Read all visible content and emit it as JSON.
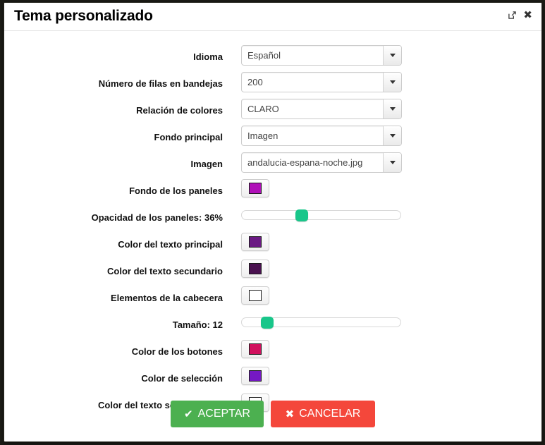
{
  "dialog": {
    "title": "Tema personalizado",
    "expand_icon": "external-link-icon",
    "close_icon": "✖"
  },
  "rows": [
    {
      "label": "Idioma",
      "type": "select",
      "value": "Español"
    },
    {
      "label": "Número de filas en bandejas",
      "type": "select",
      "value": "200"
    },
    {
      "label": "Relación de colores",
      "type": "select",
      "value": "CLARO"
    },
    {
      "label": "Fondo principal",
      "type": "select",
      "value": "Imagen"
    },
    {
      "label": "Imagen",
      "type": "select",
      "value": "andalucia-espana-noche.jpg"
    },
    {
      "label": "Fondo de los paneles",
      "type": "color",
      "color": "#b010b8"
    },
    {
      "label": "Opacidad de los paneles: 36%",
      "type": "slider",
      "percent": 36,
      "thumb_color": "#19c68a"
    },
    {
      "label": "Color del texto principal",
      "type": "color",
      "color": "#6b1a84"
    },
    {
      "label": "Color del texto secundario",
      "type": "color",
      "color": "#4a1150"
    },
    {
      "label": "Elementos de la cabecera",
      "type": "color",
      "color": "#ffffff"
    },
    {
      "label": "Tamaño: 12",
      "type": "slider",
      "percent": 12,
      "thumb_color": "#19c68a"
    },
    {
      "label": "Color de los botones",
      "type": "color",
      "color": "#d1115e"
    },
    {
      "label": "Color de selección",
      "type": "color",
      "color": "#7518c4"
    },
    {
      "label": "Color del texto seleccionado",
      "type": "color",
      "color": "#ffffff"
    }
  ],
  "footer": {
    "accept_label": "ACEPTAR",
    "accept_glyph": "✔",
    "accept_color": "#4cb050",
    "cancel_label": "CANCELAR",
    "cancel_glyph": "✖",
    "cancel_color": "#f4473b"
  }
}
